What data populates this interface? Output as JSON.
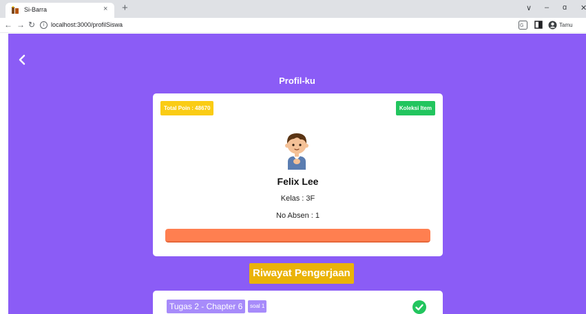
{
  "browser": {
    "tab_title": "Si-Barra",
    "tab_close": "×",
    "new_tab": "+",
    "url": "localhost:3000/profilSiswa",
    "profile_label": "Tamu",
    "window_controls": {
      "chevron": "∨",
      "minimize": "–",
      "restore": "ɑ",
      "close": "✕"
    }
  },
  "page": {
    "title": "Profil-ku",
    "background": "#8b5cf6"
  },
  "profile": {
    "total_poin": "Total Poin : 48670",
    "koleksi_label": "Koleksi Item",
    "name": "Felix Lee",
    "kelas": "Kelas : 3F",
    "absen": "No Absen : 1",
    "progress": 1.0
  },
  "history": {
    "button_label": "Riwayat Pengerjaan",
    "tasks": [
      {
        "title": "Tugas 2 - Chapter 6",
        "badge": "soal 1",
        "status": "completed"
      }
    ]
  },
  "colors": {
    "accent_purple": "#8b5cf6",
    "poin_yellow": "#facc15",
    "koleksi_green": "#22c55e",
    "progress_orange": "#ff7f50",
    "riwayat_yellow": "#eab308",
    "badge_purple": "#a78bfa",
    "check_green": "#22c55e"
  },
  "icons": [
    "favicon-icon",
    "close-icon",
    "plus-icon",
    "back-arrow-icon",
    "forward-arrow-icon",
    "reload-icon",
    "info-icon",
    "translate-icon",
    "sidepanel-icon",
    "account-icon",
    "chevron-left-icon",
    "student-avatar-icon",
    "check-circle-icon"
  ]
}
